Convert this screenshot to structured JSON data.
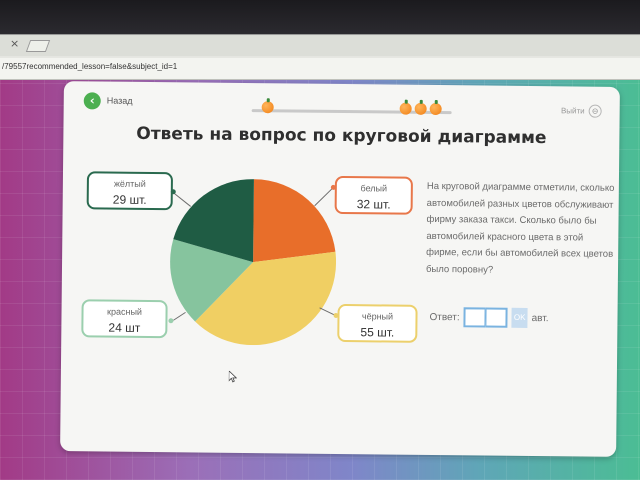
{
  "browser": {
    "url": "/79557recommended_lesson=false&subject_id=1"
  },
  "lesson": {
    "back_label": "Назад",
    "exit_label": "Выйти",
    "title": "Ответь на вопрос по круговой диаграмме",
    "progress_fruits": 4
  },
  "chart_data": {
    "type": "pie",
    "slices": [
      {
        "label": "белый",
        "value": 32,
        "unit": "шт.",
        "color": "#e86e2a"
      },
      {
        "label": "чёрный",
        "value": 55,
        "unit": "шт.",
        "color": "#f0cf63"
      },
      {
        "label": "красный",
        "value": 24,
        "unit": "шт.",
        "color": "#86c49e"
      },
      {
        "label": "жёлтый",
        "value": 29,
        "unit": "шт.",
        "color": "#1f5c44"
      }
    ],
    "legend_labels": {
      "yellow": {
        "label": "жёлтый",
        "count": "29 шт.",
        "border": "#2a6a4f"
      },
      "white": {
        "label": "белый",
        "count": "32 шт.",
        "border": "#e8774a"
      },
      "red": {
        "label": "красный",
        "count": "24 шт",
        "border": "#9bcfae"
      },
      "black": {
        "label": "чёрный",
        "count": "55 шт.",
        "border": "#ecd06c"
      }
    }
  },
  "question": {
    "text": "На круговой диаграмме отметили, сколько автомобилей разных цветов обслуживают фирму заказа такси. Сколько было бы автомобилей красного цвета в этой фирме, если бы автомобилей всех цветов было поровну?",
    "answer_label": "Ответ:",
    "answer_value_1": "",
    "answer_value_2": "",
    "ok_label": "OK",
    "unit": "авт."
  }
}
